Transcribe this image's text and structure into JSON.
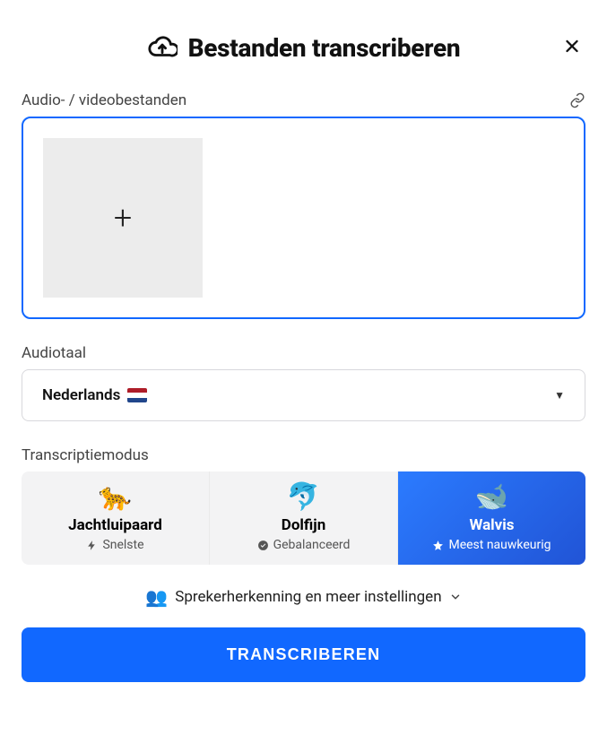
{
  "header": {
    "title": "Bestanden transcriberen"
  },
  "upload": {
    "label": "Audio- / videobestanden"
  },
  "language": {
    "label": "Audiotaal",
    "value": "Nederlands"
  },
  "mode": {
    "label": "Transcriptiemodus",
    "options": [
      {
        "emoji": "🐆",
        "title": "Jachtluipaard",
        "subtitle": "Snelste",
        "selected": false,
        "sub_icon": "bolt"
      },
      {
        "emoji": "🐬",
        "title": "Dolfijn",
        "subtitle": "Gebalanceerd",
        "selected": false,
        "sub_icon": "check"
      },
      {
        "emoji": "🐋",
        "title": "Walvis",
        "subtitle": "Meest nauwkeurig",
        "selected": true,
        "sub_icon": "star"
      }
    ]
  },
  "more_settings": {
    "emoji": "👥",
    "label": "Sprekerherkenning en meer instellingen"
  },
  "cta": {
    "label": "TRANSCRIBEREN"
  }
}
